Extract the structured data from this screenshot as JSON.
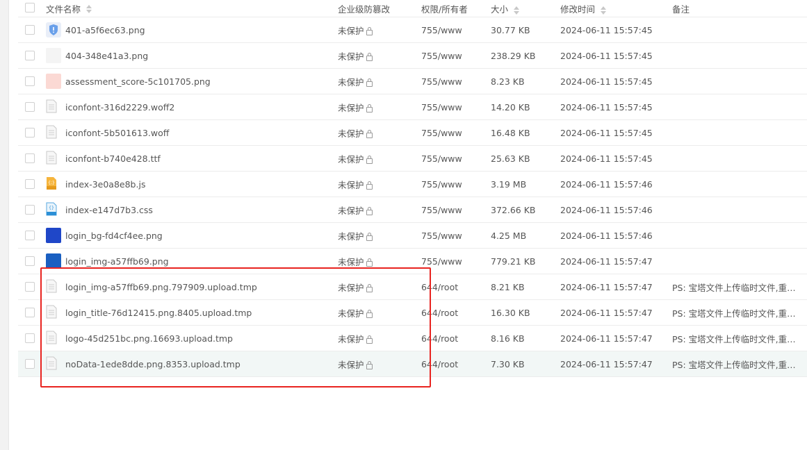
{
  "columns": {
    "name": "文件名称",
    "protection": "企业级防篡改",
    "permission": "权限/所有者",
    "size": "大小",
    "modified": "修改时间",
    "note": "备注"
  },
  "files": [
    {
      "name": "401-a5f6ec63.png",
      "icon": "shield-image-icon",
      "protection": "未保护",
      "permission": "755/www",
      "size": "30.77 KB",
      "modified": "2024-06-11 15:57:45",
      "note": ""
    },
    {
      "name": "404-348e41a3.png",
      "icon": "image-thumb-icon",
      "protection": "未保护",
      "permission": "755/www",
      "size": "238.29 KB",
      "modified": "2024-06-11 15:57:45",
      "note": ""
    },
    {
      "name": "assessment_score-5c101705.png",
      "icon": "image-thumb-icon",
      "protection": "未保护",
      "permission": "755/www",
      "size": "8.23 KB",
      "modified": "2024-06-11 15:57:45",
      "note": ""
    },
    {
      "name": "iconfont-316d2229.woff2",
      "icon": "file-icon",
      "protection": "未保护",
      "permission": "755/www",
      "size": "14.20 KB",
      "modified": "2024-06-11 15:57:45",
      "note": ""
    },
    {
      "name": "iconfont-5b501613.woff",
      "icon": "file-icon",
      "protection": "未保护",
      "permission": "755/www",
      "size": "16.48 KB",
      "modified": "2024-06-11 15:57:45",
      "note": ""
    },
    {
      "name": "iconfont-b740e428.ttf",
      "icon": "file-icon",
      "protection": "未保护",
      "permission": "755/www",
      "size": "25.63 KB",
      "modified": "2024-06-11 15:57:45",
      "note": ""
    },
    {
      "name": "index-3e0a8e8b.js",
      "icon": "js-file-icon",
      "protection": "未保护",
      "permission": "755/www",
      "size": "3.19 MB",
      "modified": "2024-06-11 15:57:46",
      "note": ""
    },
    {
      "name": "index-e147d7b3.css",
      "icon": "css-file-icon",
      "protection": "未保护",
      "permission": "755/www",
      "size": "372.66 KB",
      "modified": "2024-06-11 15:57:46",
      "note": ""
    },
    {
      "name": "login_bg-fd4cf4ee.png",
      "icon": "image-thumb-icon",
      "protection": "未保护",
      "permission": "755/www",
      "size": "4.25 MB",
      "modified": "2024-06-11 15:57:46",
      "note": ""
    },
    {
      "name": "login_img-a57ffb69.png",
      "icon": "image-thumb-icon",
      "protection": "未保护",
      "permission": "755/www",
      "size": "779.21 KB",
      "modified": "2024-06-11 15:57:47",
      "note": ""
    },
    {
      "name": "login_img-a57ffb69.png.797909.upload.tmp",
      "icon": "file-icon",
      "protection": "未保护",
      "permission": "644/root",
      "size": "8.21 KB",
      "modified": "2024-06-11 15:57:47",
      "note": "PS: 宝塔文件上传临时文件,重新..."
    },
    {
      "name": "login_title-76d12415.png.8405.upload.tmp",
      "icon": "file-icon",
      "protection": "未保护",
      "permission": "644/root",
      "size": "16.30 KB",
      "modified": "2024-06-11 15:57:47",
      "note": "PS: 宝塔文件上传临时文件,重新..."
    },
    {
      "name": "logo-45d251bc.png.16693.upload.tmp",
      "icon": "file-icon",
      "protection": "未保护",
      "permission": "644/root",
      "size": "8.16 KB",
      "modified": "2024-06-11 15:57:47",
      "note": "PS: 宝塔文件上传临时文件,重新..."
    },
    {
      "name": "noData-1ede8dde.png.8353.upload.tmp",
      "icon": "file-icon",
      "protection": "未保护",
      "permission": "644/root",
      "size": "7.30 KB",
      "modified": "2024-06-11 15:57:47",
      "note": "PS: 宝塔文件上传临时文件,重新..."
    }
  ],
  "thumb_colors": [
    "#e9eef8",
    "#f4f4f4",
    "#fbd9d4",
    "#f2f2f2",
    "#f2f2f2",
    "#f2f2f2",
    "#f4b942",
    "#2b8fd6",
    "#1f47c8",
    "#1a5fc1"
  ],
  "highlight_color": "#e8231f",
  "hover_row_index": 13
}
